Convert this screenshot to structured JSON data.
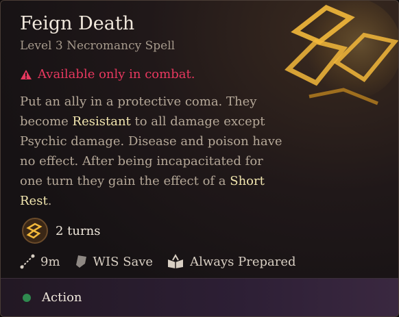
{
  "title": "Feign Death",
  "subtitle": "Level 3 Necromancy Spell",
  "warning": "Available only in combat.",
  "description": {
    "p1": "Put an ally in a protective coma. They become ",
    "resistant": "Resistant",
    "p2": " to all damage except Psychic damage. Disease and poison have no effect. After being incapacitated for one turn they gain the effect of a ",
    "short_rest": "Short Rest",
    "p3": "."
  },
  "duration": "2 turns",
  "stats": {
    "range": "9m",
    "save": "WIS Save",
    "prepared": "Always Prepared"
  },
  "footer": {
    "cost": "Action"
  },
  "colors": {
    "warning": "#e8385f",
    "highlight": "#f3e7b0",
    "action_dot": "#2f8a4f"
  }
}
